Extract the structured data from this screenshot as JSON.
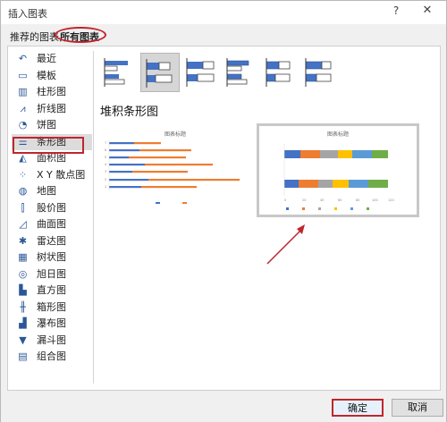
{
  "window": {
    "title": "插入图表",
    "help_glyph": "?",
    "close_glyph": "✕"
  },
  "tabs": {
    "recommended": "推荐的图表",
    "all": "所有图表"
  },
  "sidebar": {
    "items": [
      {
        "label": "最近",
        "icon": "recent-icon",
        "glyph": "↶"
      },
      {
        "label": "模板",
        "icon": "template-icon",
        "glyph": "▭"
      },
      {
        "label": "柱形图",
        "icon": "column-chart-icon",
        "glyph": "▥"
      },
      {
        "label": "折线图",
        "icon": "line-chart-icon",
        "glyph": "⩘"
      },
      {
        "label": "饼图",
        "icon": "pie-chart-icon",
        "glyph": "◔"
      },
      {
        "label": "条形图",
        "icon": "bar-chart-icon",
        "glyph": "☰"
      },
      {
        "label": "面积图",
        "icon": "area-chart-icon",
        "glyph": "◭"
      },
      {
        "label": "X Y 散点图",
        "icon": "scatter-chart-icon",
        "glyph": "⁘"
      },
      {
        "label": "地图",
        "icon": "map-chart-icon",
        "glyph": "◍"
      },
      {
        "label": "股价图",
        "icon": "stock-chart-icon",
        "glyph": "⫿"
      },
      {
        "label": "曲面图",
        "icon": "surface-chart-icon",
        "glyph": "◿"
      },
      {
        "label": "雷达图",
        "icon": "radar-chart-icon",
        "glyph": "✱"
      },
      {
        "label": "树状图",
        "icon": "treemap-chart-icon",
        "glyph": "▦"
      },
      {
        "label": "旭日图",
        "icon": "sunburst-chart-icon",
        "glyph": "◎"
      },
      {
        "label": "直方图",
        "icon": "histogram-chart-icon",
        "glyph": "▙"
      },
      {
        "label": "箱形图",
        "icon": "box-whisker-chart-icon",
        "glyph": "╫"
      },
      {
        "label": "瀑布图",
        "icon": "waterfall-chart-icon",
        "glyph": "▟"
      },
      {
        "label": "漏斗图",
        "icon": "funnel-chart-icon",
        "glyph": "▼"
      },
      {
        "label": "组合图",
        "icon": "combo-chart-icon",
        "glyph": "▤"
      }
    ],
    "active_index": 5
  },
  "main": {
    "section_title": "堆积条形图",
    "subtypes_selected": 1,
    "preview1": {
      "title": "图表标题"
    },
    "preview2": {
      "title": "图表标题"
    }
  },
  "footer": {
    "ok_label": "确定",
    "cancel_label": "取消"
  },
  "colors": {
    "highlight": "#c0262d",
    "blue": "#4472c4",
    "orange": "#ed7d31",
    "gray": "#a5a5a5",
    "yellow": "#ffc000",
    "lightblue": "#5b9bd5",
    "green": "#70ad47"
  }
}
